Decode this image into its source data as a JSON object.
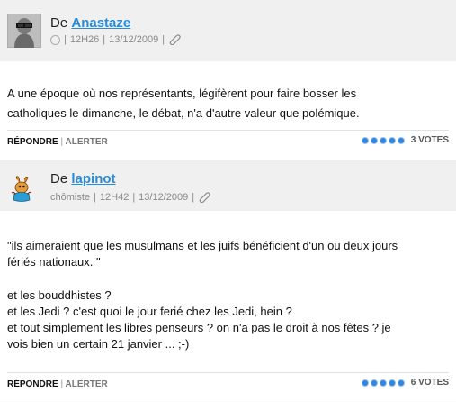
{
  "comments": [
    {
      "author_prefix": "De",
      "author": "Anastaze",
      "role": "",
      "time": "12H26",
      "date": "13/12/2009",
      "paragraphs": [
        "A une époque où nos représentants, légifèrent pour faire bosser les",
        "catholiques le dimanche, le débat, n'a d'autre valeur que polémique."
      ],
      "reply_label": "RÉPONDRE",
      "alert_label": "ALERTER",
      "votes_label": "3 VOTES",
      "vote_dots": 5,
      "avatar_icon": "sunglasses-face-icon"
    },
    {
      "author_prefix": "De",
      "author": "lapinot",
      "role": "chômiste",
      "time": "12H42",
      "date": "13/12/2009",
      "lines": [
        "\"ils aimeraient que les musulmans et les juifs bénéficient d'un ou deux jours",
        "fériés nationaux. \"",
        "et les bouddhistes ?",
        "et les Jedi ? c'est quoi le jour ferié chez les Jedi, hein ?",
        "et tout simplement les libres penseurs ? on n'a pas le droit à nos fêtes ? je",
        "vois bien un certain 21 janvier ... ;-)"
      ],
      "reply_label": "RÉPONDRE",
      "alert_label": "ALERTER",
      "votes_label": "6 VOTES",
      "vote_dots": 5,
      "avatar_icon": "rabbit-cartoon-icon"
    }
  ],
  "colors": {
    "link": "#2a8bd6",
    "header_bg": "#f0f0f0",
    "vote_dot": "#2e86de"
  }
}
